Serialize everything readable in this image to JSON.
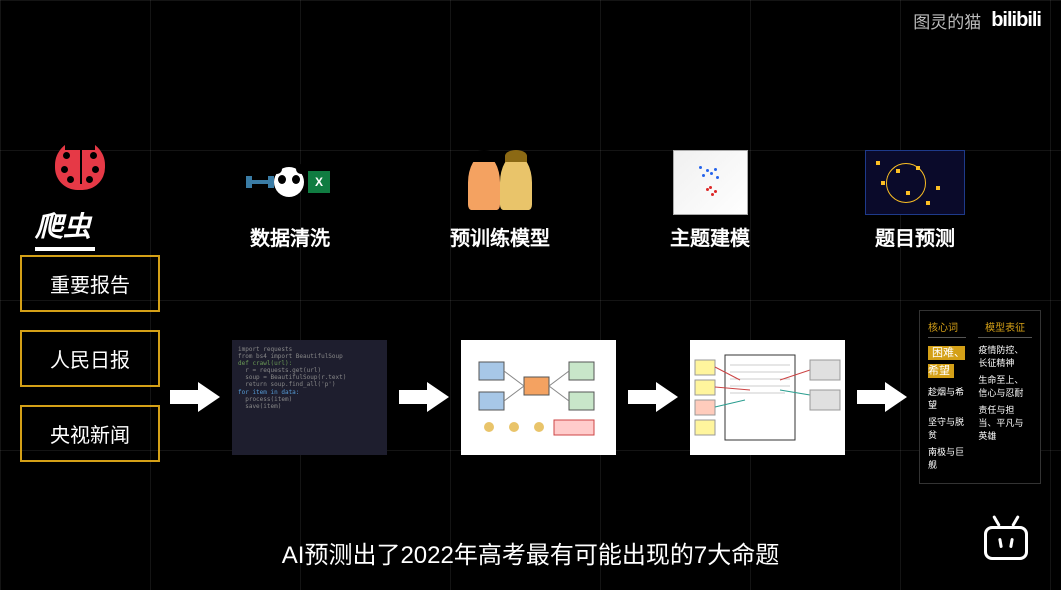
{
  "watermark": {
    "text": "图灵的猫",
    "logo": "bilibili"
  },
  "pipeline": {
    "stages": [
      {
        "label": "爬虫"
      },
      {
        "label": "数据清洗"
      },
      {
        "label": "预训练模型"
      },
      {
        "label": "主题建模"
      },
      {
        "label": "题目预测"
      }
    ]
  },
  "sources": [
    {
      "label": "重要报告"
    },
    {
      "label": "人民日报"
    },
    {
      "label": "央视新闻"
    }
  ],
  "prediction_panel": {
    "keywords_header": "核心词",
    "keywords_title": "困难、希望",
    "keywords": [
      "趁烟与希望",
      "坚守与脱贫",
      "南极与巨舰"
    ],
    "model_header": "模型表征",
    "themes": [
      "疫情防控、长征精神",
      "生命至上、信心与忍耐",
      "责任与担当、平凡与英雄"
    ]
  },
  "subtitle": "AI预测出了2022年高考最有可能出现的7大命题",
  "chart_data": {
    "type": "diagram",
    "description": "Data processing pipeline flowchart",
    "nodes": [
      "爬虫",
      "数据清洗",
      "预训练模型",
      "主题建模",
      "题目预测"
    ],
    "inputs": [
      "重要报告",
      "人民日报",
      "央视新闻"
    ],
    "flow": "left-to-right sequential arrows connecting all stages"
  }
}
